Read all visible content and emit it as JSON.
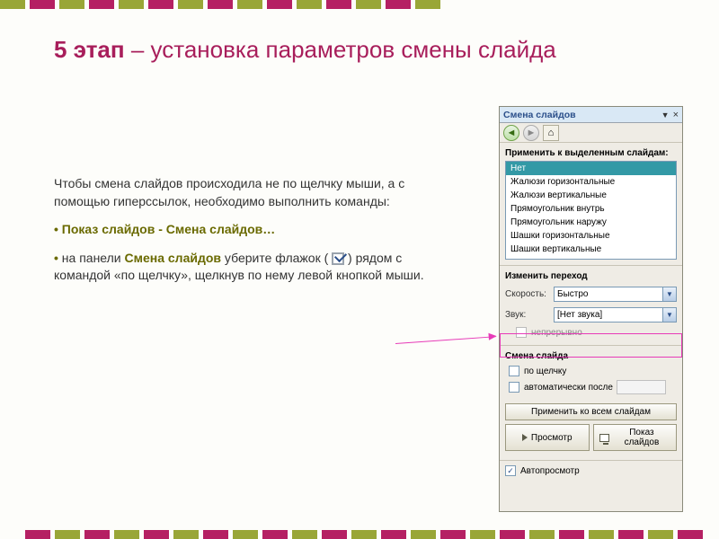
{
  "title": {
    "bold": "5 этап",
    "rest": " – установка параметров смены слайда"
  },
  "body": {
    "p1": "Чтобы смена слайдов происходила не по щелчку мыши, а с помощью гиперссылок, необходимо выполнить команды:",
    "b1": "Показ слайдов - Смена слайдов…",
    "p2a": "на панели ",
    "p2b": "Смена слайдов",
    "p2c": " уберите флажок ( ",
    "p2d": " ) рядом с командой «по щелчку», щелкнув по нему левой кнопкой мыши."
  },
  "panel": {
    "title": "Смена слайдов",
    "section_apply": "Применить к выделенным слайдам:",
    "effects": [
      "Нет",
      "Жалюзи горизонтальные",
      "Жалюзи вертикальные",
      "Прямоугольник внутрь",
      "Прямоугольник наружу",
      "Шашки горизонтальные",
      "Шашки вертикальные"
    ],
    "section_modify": "Изменить переход",
    "speed_label": "Скорость:",
    "speed_value": "Быстро",
    "sound_label": "Звук:",
    "sound_value": "[Нет звука]",
    "loop_label": "непрерывно",
    "section_advance": "Смена слайда",
    "on_click": "по щелчку",
    "auto_after": "автоматически после",
    "apply_all": "Применить ко всем слайдам",
    "preview": "Просмотр",
    "slideshow": "Показ слайдов",
    "autopreview": "Автопросмотр"
  }
}
